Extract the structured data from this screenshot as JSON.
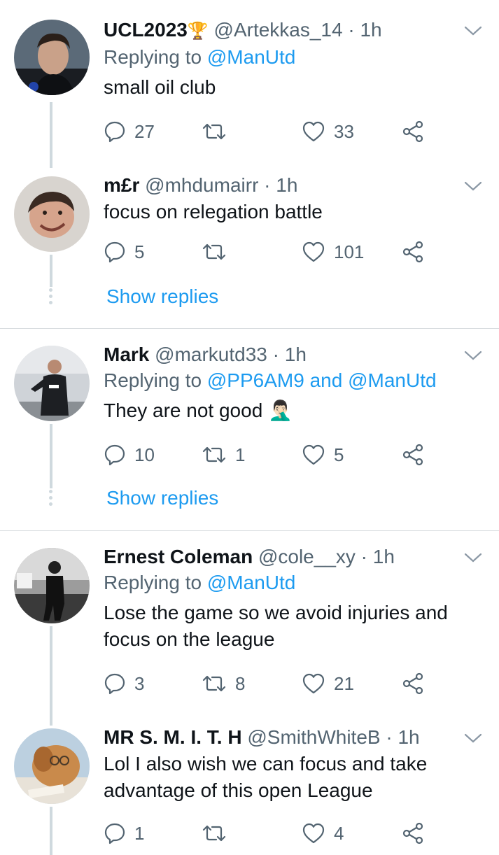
{
  "tweets": [
    {
      "display_name": "UCL2023",
      "badge": "🏆",
      "handle": "@Artekkas_14",
      "separator": "·",
      "time": "1h",
      "replying_prefix": "Replying to",
      "replying_to": [
        "@ManUtd"
      ],
      "text": "small oil club",
      "replies": "27",
      "retweets": "",
      "likes": "33"
    },
    {
      "display_name": "m£r",
      "handle": "@mhdumairr",
      "separator": "·",
      "time": "1h",
      "text": "focus on relegation battle",
      "replies": "5",
      "retweets": "",
      "likes": "101",
      "show_replies": "Show replies"
    },
    {
      "display_name": "Mark",
      "handle": "@markutd33",
      "separator": "·",
      "time": "1h",
      "replying_prefix": "Replying to",
      "replying_to": [
        "@PP6AM9",
        "@ManUtd"
      ],
      "replying_joiner": "and",
      "text": "They are not good",
      "emoji": "🤦🏻‍♂️",
      "replies": "10",
      "retweets": "1",
      "likes": "5",
      "show_replies": "Show replies"
    },
    {
      "display_name": "Ernest Coleman",
      "handle": "@cole__xy",
      "separator": "·",
      "time": "1h",
      "replying_prefix": "Replying to",
      "replying_to": [
        "@ManUtd"
      ],
      "text_line1": "Lose the game so we avoid injuries and",
      "text_line2": "focus on the league",
      "replies": "3",
      "retweets": "8",
      "likes": "21"
    },
    {
      "display_name": "MR S. M. I. T. H",
      "handle": "@SmithWhiteB",
      "separator": "·",
      "time": "1h",
      "text_line1": "Lol I also wish we can focus and take",
      "text_line2": "advantage of this open League",
      "replies": "1",
      "retweets": "",
      "likes": "4"
    }
  ],
  "colors": {
    "accent": "#1d9bf0",
    "secondary_text": "#536471",
    "thread_line": "#cfd9de"
  },
  "icons": [
    "reply-icon",
    "retweet-icon",
    "like-icon",
    "share-icon",
    "chevron-down-icon"
  ]
}
